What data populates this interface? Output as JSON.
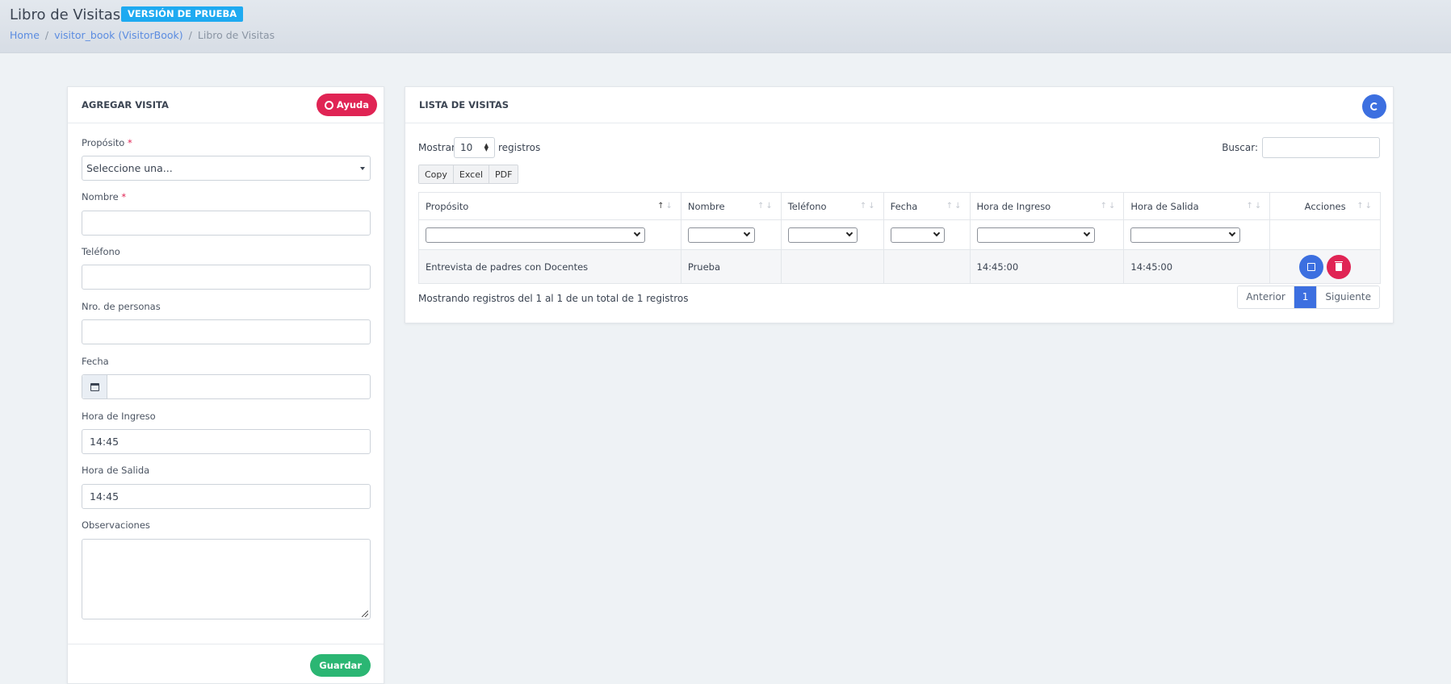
{
  "header": {
    "title": "Libro de Visitas",
    "badge": "VERSIÓN DE PRUEBA",
    "breadcrumb": [
      "Home",
      "visitor_book (VisitorBook)",
      "Libro de Visitas"
    ]
  },
  "form": {
    "title": "AGREGAR VISITA",
    "help_label": "Ayuda",
    "fields": {
      "purpose": {
        "label": "Propósito",
        "required": "*",
        "value": "Seleccione una..."
      },
      "name": {
        "label": "Nombre",
        "required": "*",
        "value": ""
      },
      "phone": {
        "label": "Teléfono",
        "value": ""
      },
      "people": {
        "label": "Nro. de personas",
        "value": ""
      },
      "date": {
        "label": "Fecha",
        "value": ""
      },
      "time_in": {
        "label": "Hora de Ingreso",
        "value": "14:45"
      },
      "time_out": {
        "label": "Hora de Salida",
        "value": "14:45"
      },
      "notes": {
        "label": "Observaciones",
        "value": ""
      }
    },
    "save_label": "Guardar"
  },
  "list": {
    "title": "LISTA DE VISITAS",
    "show_label": "Mostrar",
    "page_length": "10",
    "records_label": "registros",
    "search_label": "Buscar:",
    "buttons": [
      "Copy",
      "Excel",
      "PDF"
    ],
    "columns": [
      "Propósito",
      "Nombre",
      "Teléfono",
      "Fecha",
      "Hora de Ingreso",
      "Hora de Salida",
      "Acciones"
    ],
    "rows": [
      {
        "purpose": "Entrevista de padres con Docentes",
        "name": "Prueba",
        "phone": "",
        "date": "",
        "time_in": "14:45:00",
        "time_out": "14:45:00"
      }
    ],
    "info": "Mostrando registros del 1 al 1 de un total de 1 registros",
    "pager": {
      "prev": "Anterior",
      "current": "1",
      "next": "Siguiente"
    }
  },
  "colors": {
    "accent_blue": "#3c6fe0",
    "danger": "#e02454",
    "success": "#2bb673",
    "badge": "#1eaaf1"
  }
}
